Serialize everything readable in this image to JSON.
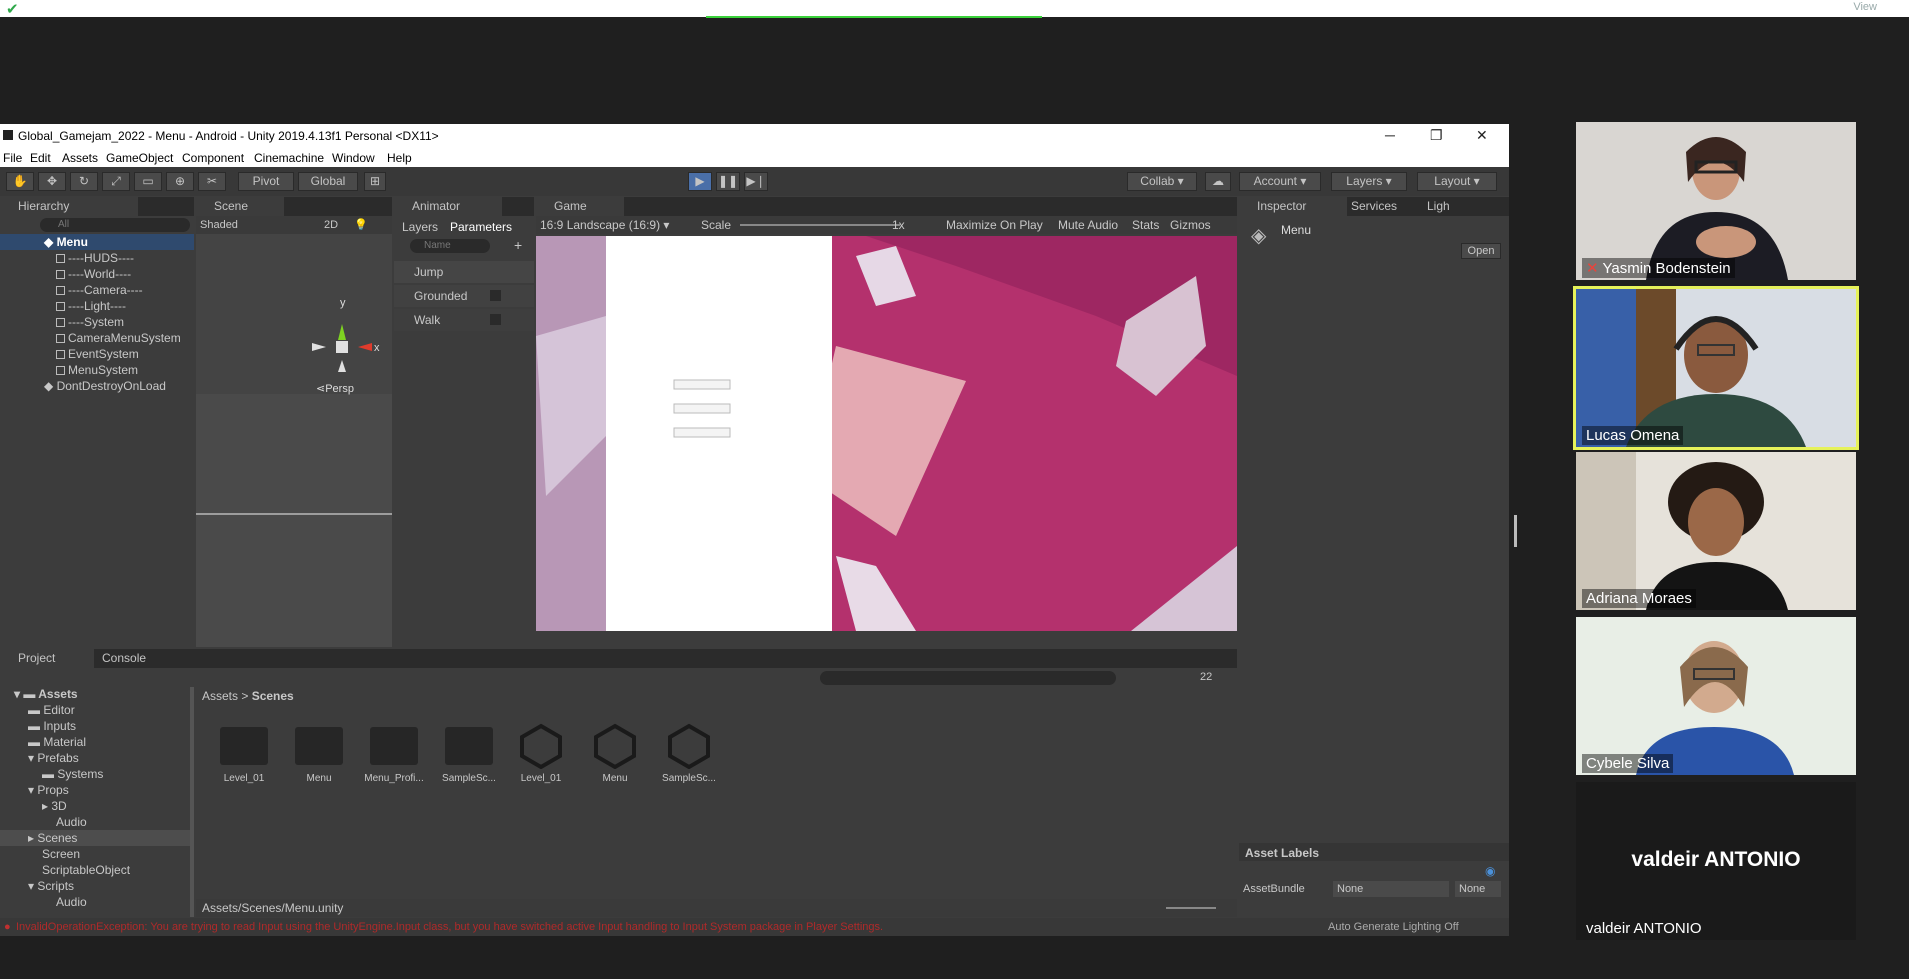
{
  "meeting": {
    "view_label": "View",
    "participants": [
      {
        "name": "Yasmin Bodenstein",
        "muted": true
      },
      {
        "name": "Lucas Omena",
        "active_speaker": true
      },
      {
        "name": "Adriana Moraes"
      },
      {
        "name": "Cybele Silva"
      },
      {
        "name": "valdeir ANTONIO",
        "display_text": "valdeir ANTONIO",
        "video_off": true
      }
    ]
  },
  "unity": {
    "window_title": "Global_Gamejam_2022 - Menu - Android - Unity 2019.4.13f1 Personal <DX11>",
    "menu": [
      "File",
      "Edit",
      "Assets",
      "GameObject",
      "Component",
      "Cinemachine",
      "Window",
      "Help"
    ],
    "toolbar": {
      "pivot": "Pivot",
      "global": "Global",
      "collab": "Collab",
      "account": "Account",
      "layers": "Layers",
      "layout": "Layout"
    },
    "hierarchy": {
      "tab": "Hierarchy",
      "search_placeholder": "All",
      "scene_root": "Menu",
      "items": [
        "----HUDS----",
        "----World----",
        "----Camera----",
        "----Light----",
        "----System",
        "CameraMenuSystem",
        "EventSystem",
        "MenuSystem",
        "DontDestroyOnLoad"
      ]
    },
    "scene": {
      "tab": "Scene",
      "shading": "Shaded",
      "mode_2d": "2D",
      "persp": "Persp",
      "axis_y": "y",
      "axis_x": "x"
    },
    "animator": {
      "tab": "Animator",
      "subtab_layers": "Layers",
      "subtab_parameters": "Parameters",
      "name_placeholder": "Name",
      "params": [
        "Jump",
        "Grounded",
        "Walk"
      ]
    },
    "game": {
      "tab": "Game",
      "aspect": "16:9 Landscape (16:9)",
      "scale_label": "Scale",
      "scale_value": "1x",
      "maximize": "Maximize On Play",
      "mute": "Mute Audio",
      "stats": "Stats",
      "gizmos": "Gizmos"
    },
    "inspector": {
      "tab": "Inspector",
      "tab_services": "Services",
      "tab_lighting": "Ligh",
      "object": "Menu",
      "open_button": "Open",
      "asset_labels": "Asset Labels",
      "asset_bundle_label": "AssetBundle",
      "asset_bundle_value": "None",
      "asset_bundle_variant": "None"
    },
    "project": {
      "tab": "Project",
      "tab_console": "Console",
      "tree": [
        {
          "label": "Assets",
          "level": 0
        },
        {
          "label": "Editor",
          "level": 1
        },
        {
          "label": "Inputs",
          "level": 1
        },
        {
          "label": "Material",
          "level": 1
        },
        {
          "label": "Prefabs",
          "level": 1
        },
        {
          "label": "Systems",
          "level": 2
        },
        {
          "label": "Props",
          "level": 1
        },
        {
          "label": "3D",
          "level": 2
        },
        {
          "label": "Audio",
          "level": 2
        },
        {
          "label": "Scenes",
          "level": 1
        },
        {
          "label": "Screen",
          "level": 1
        },
        {
          "label": "ScriptableObject",
          "level": 1
        },
        {
          "label": "Scripts",
          "level": 1
        },
        {
          "label": "Audio",
          "level": 2
        }
      ],
      "breadcrumb_root": "Assets",
      "breadcrumb_current": "Scenes",
      "assets": [
        {
          "label": "Level_01",
          "kind": "folder"
        },
        {
          "label": "Menu",
          "kind": "folder"
        },
        {
          "label": "Menu_Profi...",
          "kind": "folder"
        },
        {
          "label": "SampleSc...",
          "kind": "folder"
        },
        {
          "label": "Level_01",
          "kind": "scene"
        },
        {
          "label": "Menu",
          "kind": "scene"
        },
        {
          "label": "SampleSc...",
          "kind": "scene"
        }
      ],
      "path": "Assets/Scenes/Menu.unity",
      "count": "22"
    },
    "status": {
      "error": "InvalidOperationException: You are trying to read Input using the UnityEngine.Input class, but you have switched active Input handling to Input System package in Player Settings.",
      "right": "Auto Generate Lighting Off"
    }
  }
}
